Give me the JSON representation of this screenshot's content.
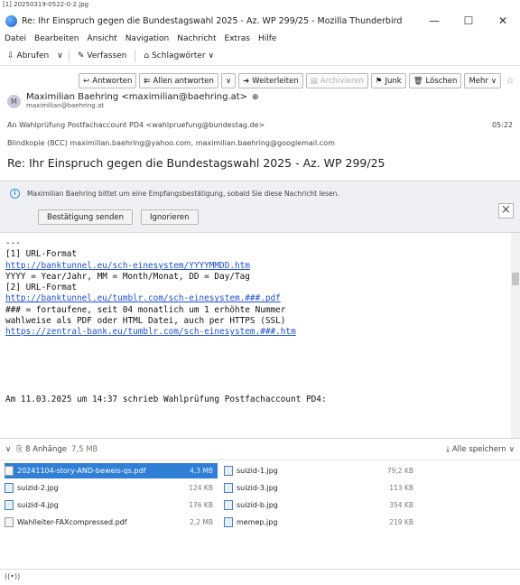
{
  "caption": "[1] 20250319-0522-0-2.jpg",
  "window": {
    "title": "Re: Ihr Einspruch gegen die Bundestagswahl 2025 - Az. WP 299/25 - Mozilla Thunderbird",
    "minimize": "—",
    "maximize": "☐",
    "close": "✕"
  },
  "menu": [
    "Datei",
    "Bearbeiten",
    "Ansicht",
    "Navigation",
    "Nachricht",
    "Extras",
    "Hilfe"
  ],
  "toolbar": {
    "fetch": "Abrufen",
    "compose": "Verfassen",
    "tags": "Schlagwörter"
  },
  "actions": {
    "reply": "Antworten",
    "reply_all": "Allen antworten",
    "forward": "Weiterleiten",
    "archive": "Archivieren",
    "junk": "Junk",
    "delete": "Löschen",
    "more": "Mehr"
  },
  "header": {
    "avatar_letter": "M",
    "from": "Maximilian Baehring <maximilian@baehring.at>",
    "from_sub": "maximilian@baehring.at",
    "to_label": "An",
    "to": "Wahlprüfung Postfachaccount PD4 <wahlpruefung@bundestag.de>",
    "time": "05:22",
    "bcc_label": "Blindkopie (BCC)",
    "bcc": "maximilian.baehring@yahoo.com, maximilian.baehring@googlemail.com",
    "subject": "Re: Ihr Einspruch gegen die Bundestagswahl 2025 - Az. WP 299/25"
  },
  "notice": {
    "text": "Maximilian Baehring bittet um eine Empfangsbestätigung, sobald Sie diese Nachricht lesen.",
    "send": "Bestätigung senden",
    "ignore": "Ignorieren",
    "close": "×"
  },
  "body": {
    "l1": "---",
    "l2": "[1] URL-Format",
    "l3": "http://banktunnel.eu/sch-einesystem/YYYYMMDD.htm",
    "l4": "YYYY = Year/Jahr, MM = Month/Monat, DD = Day/Tag",
    "l5": "[2] URL-Format",
    "l6": "http://banktunnel.eu/tumblr.com/sch-einesystem.###.pdf",
    "l7": "### = fortaufene, seit 04 monatlich um 1 erhöhte Nummer",
    "l8": "wahlweise als PDF oder HTML Datei, auch per HTTPS (SSL)",
    "l9": "https://zentral-bank.eu/tumblr.com/sch-einesystem.###.htm",
    "l10": "Am 11.03.2025 um 14:37 schrieb Wahlprüfung Postfachaccount PD4:"
  },
  "attachments": {
    "summary": "8 Anhänge",
    "total_size": "7,5 MB",
    "save_all": "Alle speichern",
    "items": [
      {
        "name": "20241104-story-AND-beweis-qs.pdf",
        "size": "4,3 MB",
        "selected": true
      },
      {
        "name": "suizid-1.jpg",
        "size": "79,2 KB"
      },
      {
        "name": "suizid-2.jpg",
        "size": "124 KB"
      },
      {
        "name": "suizid-3.jpg",
        "size": "113 KB"
      },
      {
        "name": "suizid-4.jpg",
        "size": "176 KB"
      },
      {
        "name": "suizid-b.jpg",
        "size": "354 KB"
      },
      {
        "name": "Wahlleiter-FAXcompressed.pdf",
        "size": "2,2 MB"
      },
      {
        "name": "memep.jpg",
        "size": "219 KB"
      }
    ]
  },
  "status": {
    "icon": "((•))"
  }
}
